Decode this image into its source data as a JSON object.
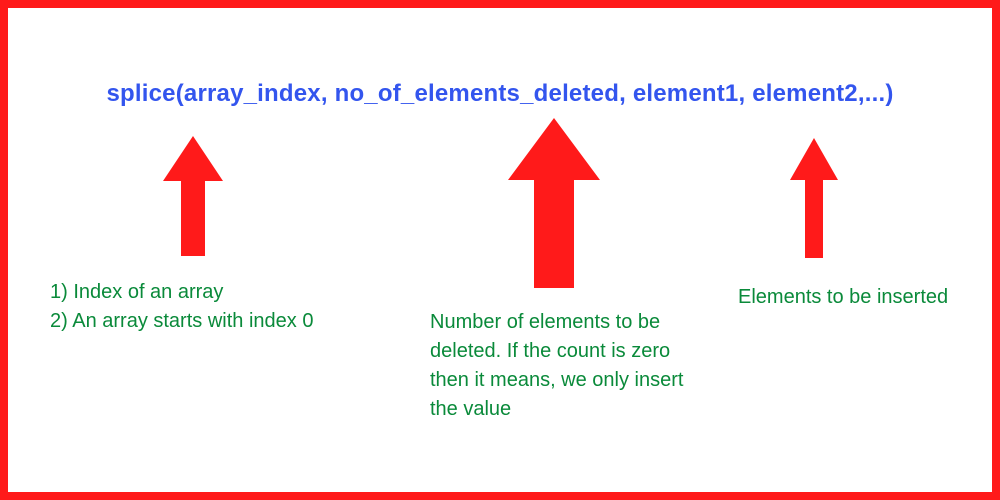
{
  "signature": "splice(array_index, no_of_elements_deleted, element1, element2,...)",
  "notes": {
    "index_l1": "1) Index of an array",
    "index_l2": "2) An array starts with index 0",
    "deleted": "Number of elements to be deleted. If the count is zero then it means, we only insert the value",
    "inserted": "Elements to be inserted"
  },
  "colors": {
    "border": "#ff1a1a",
    "arrow": "#ff1a1a",
    "signature": "#3355ee",
    "note": "#0a8a3a"
  }
}
